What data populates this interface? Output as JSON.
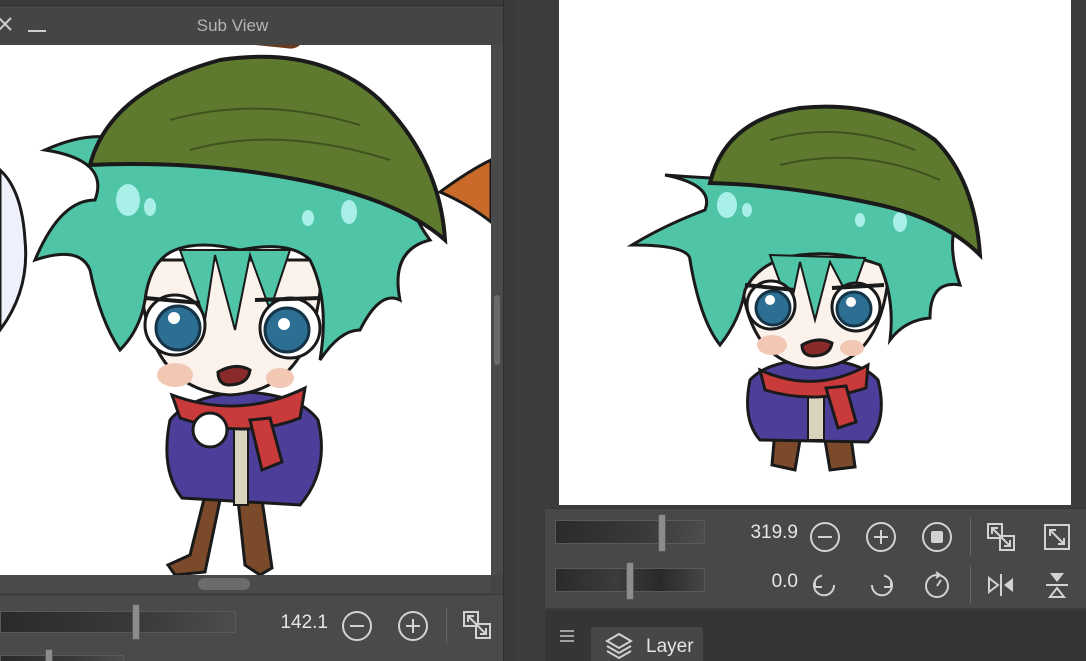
{
  "subview": {
    "title": "Sub View",
    "zoom_value": "142.1",
    "icons": [
      "close-icon",
      "minimize-icon",
      "zoom-out-icon",
      "zoom-in-icon",
      "fit-window-icon"
    ]
  },
  "navigator": {
    "zoom_value": "319.9",
    "rotation_value": "0.0",
    "icons": [
      "zoom-out-icon",
      "zoom-in-icon",
      "stop-icon",
      "fit-window-icon",
      "actual-size-icon",
      "rotate-left-icon",
      "rotate-right-icon",
      "reset-rotation-icon",
      "flip-horizontal-icon",
      "flip-vertical-icon"
    ]
  },
  "layer_panel": {
    "tab_label": "Layer",
    "icons": [
      "menu-icon",
      "layers-icon"
    ]
  },
  "colors": {
    "panel_bg": "#454545",
    "canvas_bg": "#ffffff",
    "hair": "#4fc4a6",
    "hat": "#5e7a2e",
    "jacket": "#4b3f9a",
    "scarf": "#c93a3a"
  }
}
